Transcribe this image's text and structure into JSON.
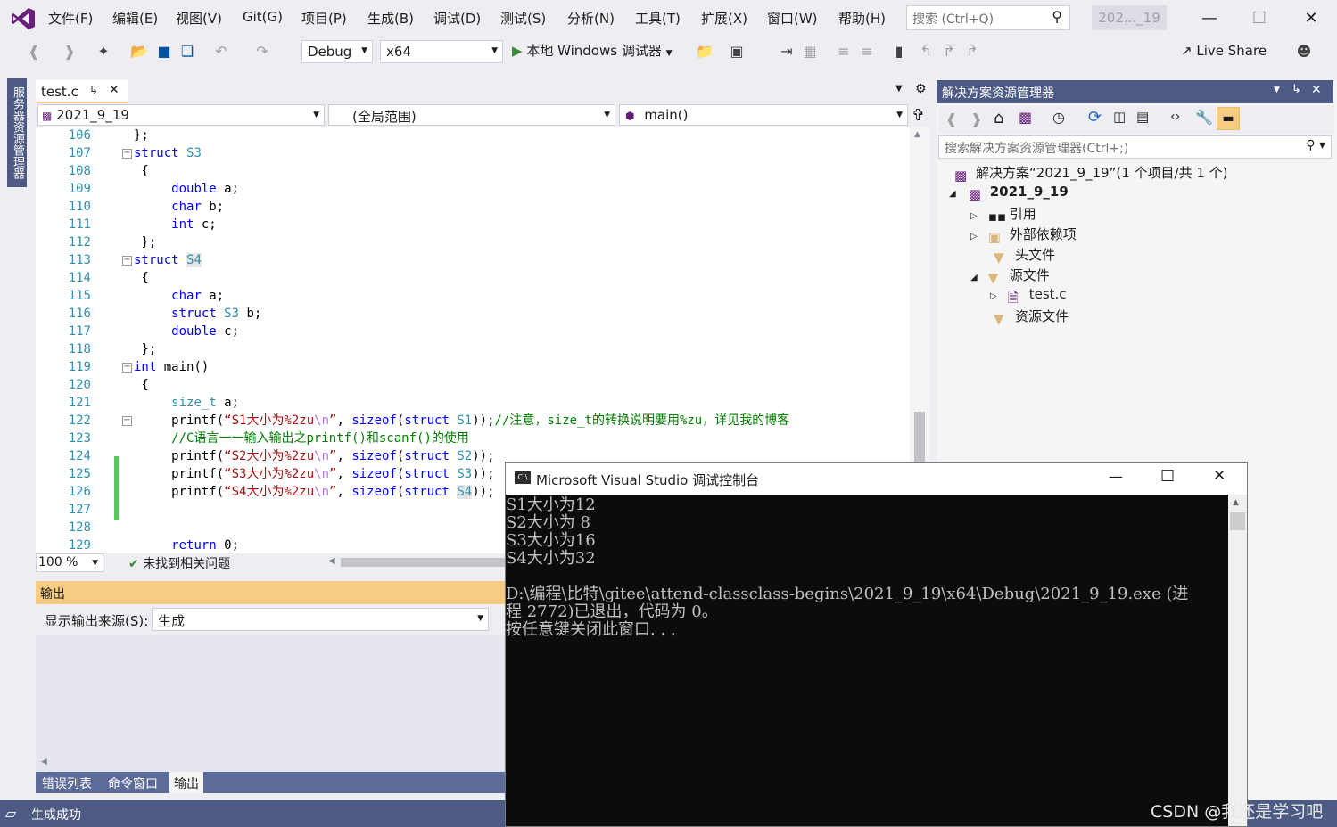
{
  "menu": {
    "items": [
      "文件(F)",
      "编辑(E)",
      "视图(V)",
      "Git(G)",
      "项目(P)",
      "生成(B)",
      "调试(D)",
      "测试(S)",
      "分析(N)",
      "工具(T)",
      "扩展(X)",
      "窗口(W)",
      "帮助(H)"
    ],
    "search_placeholder": "搜索 (Ctrl+Q)",
    "solution_badge": "202..._19"
  },
  "toolbar": {
    "config": "Debug",
    "platform": "x64",
    "run_label": "本地 Windows 调试器",
    "live_share": "Live Share"
  },
  "left_tab": "服务器资源管理器",
  "editor": {
    "tab_name": "test.c",
    "nav_project": "2021_9_19",
    "nav_scope": "(全局范围)",
    "nav_member": "main()",
    "zoom": "100 %",
    "issues": "未找到相关问题",
    "line_numbers": [
      "106",
      "107",
      "108",
      "109",
      "110",
      "111",
      "112",
      "113",
      "114",
      "115",
      "116",
      "117",
      "118",
      "119",
      "120",
      "121",
      "122",
      "123",
      "124",
      "125",
      "126",
      "127",
      "128",
      "129"
    ]
  },
  "output": {
    "title": "输出",
    "source_label": "显示输出来源(S):",
    "source_value": "生成"
  },
  "bottom_tabs": [
    "错误列表",
    "命令窗口",
    "输出"
  ],
  "status": {
    "text": "生成成功"
  },
  "solution_explorer": {
    "title": "解决方案资源管理器",
    "search_placeholder": "搜索解决方案资源管理器(Ctrl+;)",
    "solution": "解决方案“2021_9_19”(1 个项目/共 1 个)",
    "project": "2021_9_19",
    "items": [
      "引用",
      "外部依赖项",
      "头文件",
      "源文件",
      "test.c",
      "资源文件"
    ]
  },
  "console": {
    "title": "Microsoft Visual Studio 调试控制台",
    "lines": [
      "S1大小为12",
      "S2大小为 8",
      "S3大小为16",
      "S4大小为32",
      "",
      "D:\\编程\\比特\\gitee\\attend-classclass-begins\\2021_9_19\\x64\\Debug\\2021_9_19.exe (进",
      "程 2772)已退出，代码为 0。",
      "按任意键关闭此窗口. . ."
    ]
  },
  "watermark": "CSDN @我还是学习吧"
}
